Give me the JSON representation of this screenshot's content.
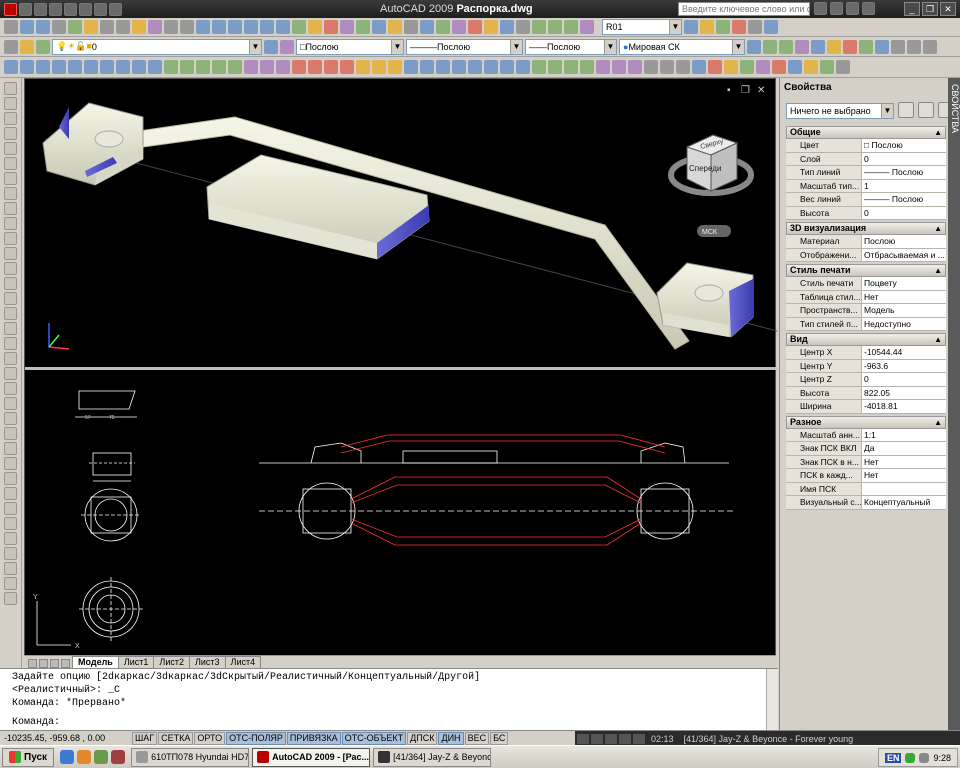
{
  "window": {
    "title_app": "AutoCAD 2009",
    "title_file": "Распорка.dwg",
    "search_placeholder": "Введите ключевое слово или фразу"
  },
  "toolbar_row2": {
    "layer_value": "0",
    "workspace_value": "R01"
  },
  "toolbar_row3": {
    "layer_combo": "0",
    "color_combo": "Послою",
    "linetype_combo": "Послою",
    "lineweight_combo": "Послою",
    "ucs_combo": "Мировая СК"
  },
  "viewcube": {
    "top_label": "Сверху",
    "front_label": "Спереди",
    "ucs_badge": "МСК"
  },
  "layout_tabs": [
    "Модель",
    "Лист1",
    "Лист2",
    "Лист3",
    "Лист4"
  ],
  "command_history": [
    "Задайте опцию [2dкаркас/3dкаркас/3dСкрытый/Реалистичный/Концептуальный/Другой]",
    "<Реалистичный>: _С",
    "Команда: *Прервано*"
  ],
  "command_prompt": "Команда:",
  "status_coords": "-10235.45, -959.68 , 0.00",
  "status_buttons": [
    {
      "label": "ШАГ",
      "on": false
    },
    {
      "label": "СЕТКА",
      "on": false
    },
    {
      "label": "ОРТО",
      "on": false
    },
    {
      "label": "ОТС-ПОЛЯР",
      "on": true
    },
    {
      "label": "ПРИВЯЗКА",
      "on": true
    },
    {
      "label": "ОТС-ОБЪЕКТ",
      "on": true
    },
    {
      "label": "ДПСК",
      "on": false
    },
    {
      "label": "ДИН",
      "on": true
    },
    {
      "label": "ВЕС",
      "on": false
    },
    {
      "label": "БС",
      "on": false
    }
  ],
  "media_player": {
    "time": "02:13",
    "track": "[41/364] Jay-Z & Beyonce - Forever young"
  },
  "taskbar": {
    "start_label": "Пуск",
    "tasks": [
      {
        "label": "610ТП078 Hyundai HD78...",
        "active": false
      },
      {
        "label": "AutoCAD 2009 - [Рас...",
        "active": true
      },
      {
        "label": "[41/364] Jay-Z & Beyonc...",
        "active": false
      }
    ],
    "lang": "EN",
    "clock": "9:28"
  },
  "properties": {
    "header": "Свойства",
    "selection": "Ничего не выбрано",
    "palette_title": "СВОЙСТВА",
    "groups": [
      {
        "title": "Общие",
        "rows": [
          {
            "name": "Цвет",
            "value": "Послою"
          },
          {
            "name": "Слой",
            "value": "0"
          },
          {
            "name": "Тип линий",
            "value": "Послою"
          },
          {
            "name": "Масштаб тип...",
            "value": "1"
          },
          {
            "name": "Вес линий",
            "value": "Послою"
          },
          {
            "name": "Высота",
            "value": "0"
          }
        ]
      },
      {
        "title": "3D визуализация",
        "rows": [
          {
            "name": "Материал",
            "value": "Послою"
          },
          {
            "name": "Отображени...",
            "value": "Отбрасываемая и ..."
          }
        ]
      },
      {
        "title": "Стиль печати",
        "rows": [
          {
            "name": "Стиль печати",
            "value": "Поцвету"
          },
          {
            "name": "Таблица стил...",
            "value": "Нет"
          },
          {
            "name": "Пространств...",
            "value": "Модель"
          },
          {
            "name": "Тип стилей п...",
            "value": "Недоступно"
          }
        ]
      },
      {
        "title": "Вид",
        "rows": [
          {
            "name": "Центр X",
            "value": "-10544.44"
          },
          {
            "name": "Центр Y",
            "value": "-963.6"
          },
          {
            "name": "Центр Z",
            "value": "0"
          },
          {
            "name": "Высота",
            "value": "822.05"
          },
          {
            "name": "Ширина",
            "value": "-4018.81"
          }
        ]
      },
      {
        "title": "Разное",
        "rows": [
          {
            "name": "Масштаб анн...",
            "value": "1:1"
          },
          {
            "name": "Знак ПСК ВКЛ",
            "value": "Да"
          },
          {
            "name": "Знак ПСК в н...",
            "value": "Нет"
          },
          {
            "name": "ПСК в кажд...",
            "value": "Нет"
          },
          {
            "name": "Имя ПСК",
            "value": ""
          },
          {
            "name": "Визуальный с...",
            "value": "Концептуальный"
          }
        ]
      }
    ]
  }
}
